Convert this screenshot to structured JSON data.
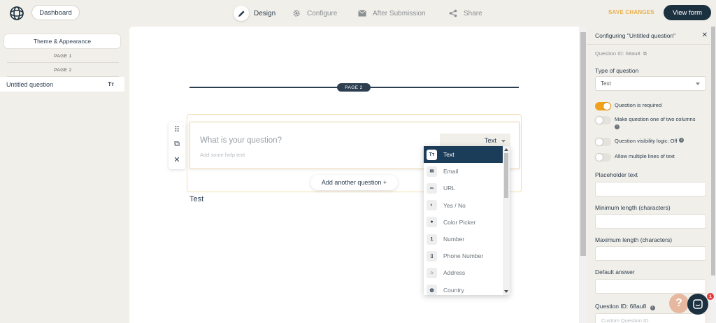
{
  "header": {
    "dashboard_label": "Dashboard",
    "tabs": [
      {
        "label": "Design",
        "icon": "pencil-icon",
        "active": true
      },
      {
        "label": "Configure",
        "icon": "gear-icon",
        "active": false
      },
      {
        "label": "After Submission",
        "icon": "envelope-icon",
        "active": false
      },
      {
        "label": "Share",
        "icon": "share-icon",
        "active": false
      }
    ],
    "save_label": "SAVE CHANGES",
    "view_label": "View form"
  },
  "sidebar": {
    "theme_label": "Theme & Appearance",
    "page1_label": "PAGE 1",
    "page2_label": "PAGE 2",
    "question_label": "Untitled question",
    "question_type_icon": "Tт"
  },
  "canvas": {
    "page_badge": "PAGE 2",
    "question_placeholder": "What is your question?",
    "help_placeholder": "Add some help text",
    "type_value": "Text",
    "add_question_label": "Add another question +",
    "test_label": "Test",
    "type_options": [
      {
        "label": "Text",
        "icon": "Tт",
        "selected": true
      },
      {
        "label": "Email",
        "icon": "✉",
        "selected": false
      },
      {
        "label": "URL",
        "icon": "∞",
        "selected": false
      },
      {
        "label": "Yes / No",
        "icon": "◐",
        "selected": false
      },
      {
        "label": "Color Picker",
        "icon": "●",
        "selected": false
      },
      {
        "label": "Number",
        "icon": "1",
        "selected": false
      },
      {
        "label": "Phone Number",
        "icon": "▯",
        "selected": false
      },
      {
        "label": "Address",
        "icon": "⌂",
        "selected": false
      },
      {
        "label": "Country",
        "icon": "◍",
        "selected": false
      }
    ]
  },
  "config": {
    "title": "Configuring \"Untitled question\"",
    "question_id_small": "Question ID: 68au8",
    "type_label": "Type of question",
    "type_value": "Text",
    "toggles": [
      {
        "label": "Question is required",
        "on": true
      },
      {
        "label": "Make question one of two columns",
        "on": false
      },
      {
        "label": "Question visibility logic: Off",
        "on": false
      },
      {
        "label": "Allow multiple lines of text",
        "on": false
      }
    ],
    "placeholder_label": "Placeholder text",
    "min_label": "Minimum length (characters)",
    "max_label": "Maximum length (characters)",
    "default_label": "Default answer",
    "qid_label": "Question ID: 68au8",
    "custom_id_placeholder": "Custom Question ID"
  },
  "chat": {
    "badge": "1"
  }
}
